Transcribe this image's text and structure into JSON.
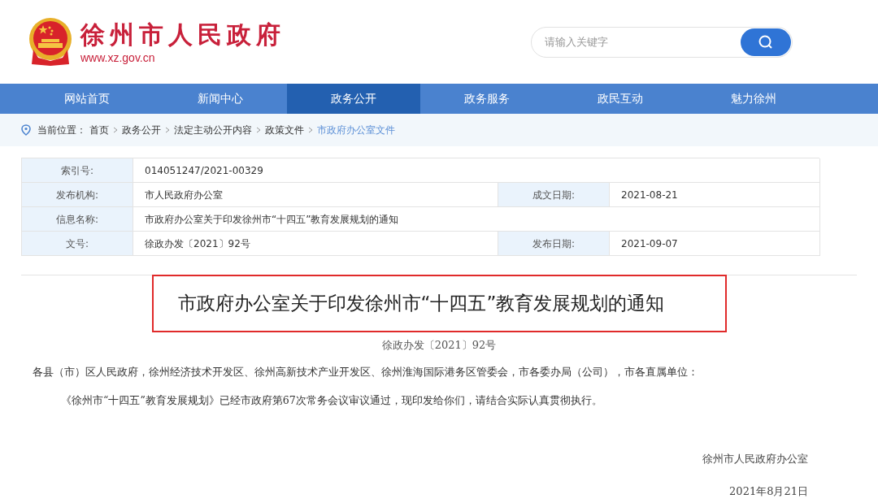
{
  "header": {
    "site_name": "徐州市人民政府",
    "url": "www.xz.gov.cn",
    "search": {
      "placeholder": "请输入关键字"
    }
  },
  "nav": [
    {
      "label": "网站首页",
      "selected": false
    },
    {
      "label": "新闻中心",
      "selected": false
    },
    {
      "label": "政务公开",
      "selected": true
    },
    {
      "label": "政务服务",
      "selected": false
    },
    {
      "label": "政民互动",
      "selected": false
    },
    {
      "label": "魅力徐州",
      "selected": false
    }
  ],
  "breadcrumb": {
    "label": "当前位置：",
    "items": [
      {
        "text": "首页",
        "current": false
      },
      {
        "text": "政务公开",
        "current": false
      },
      {
        "text": "法定主动公开内容",
        "current": false
      },
      {
        "text": "政策文件",
        "current": false
      },
      {
        "text": "市政府办公室文件",
        "current": true
      }
    ]
  },
  "info_table": [
    [
      {
        "label": "索引号:",
        "value": "014051247/2021-00329"
      }
    ],
    [
      {
        "label": "发布机构:",
        "value": "市人民政府办公室"
      },
      {
        "label": "成文日期:",
        "value": "2021-08-21"
      }
    ],
    [
      {
        "label": "信息名称:",
        "value": "市政府办公室关于印发徐州市“十四五”教育发展规划的通知"
      }
    ],
    [
      {
        "label": "文号:",
        "value": "徐政办发〔2021〕92号"
      },
      {
        "label": "发布日期:",
        "value": "2021-09-07"
      }
    ]
  ],
  "article": {
    "title": "市政府办公室关于印发徐州市“十四五”教育发展规划的通知",
    "doc_number": "徐政办发〔2021〕92号",
    "paragraphs": [
      {
        "text": "各县（市）区人民政府，徐州经济技术开发区、徐州高新技术产业开发区、徐州淮海国际港务区管委会，市各委办局（公司），市各直属单位：",
        "indent": false
      },
      {
        "text": "《徐州市“十四五”教育发展规划》已经市政府第67次常务会议审议通过，现印发给你们，请结合实际认真贯彻执行。",
        "indent": true
      }
    ],
    "signature": "徐州市人民政府办公室",
    "date": "2021年8月21日"
  }
}
